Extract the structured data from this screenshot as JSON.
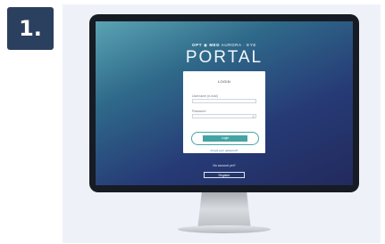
{
  "step": {
    "label": "1."
  },
  "portal": {
    "logo_part1": "OPT",
    "logo_part2": "MED",
    "logo_part3": "AURORA · EYE",
    "title": "PORTAL"
  },
  "login": {
    "heading": "LOGIN",
    "username_label": "Username (e-mail)",
    "password_label": "Password",
    "button_label": "Login",
    "forgot_link": "Forgot your password?"
  },
  "register": {
    "prompt": "No account yet?",
    "button_label": "Register"
  },
  "colors": {
    "badge": "#2b3f5e",
    "accent": "#43a4a3",
    "screen_top": "#5aa3b3",
    "screen_bottom": "#222a5c"
  }
}
